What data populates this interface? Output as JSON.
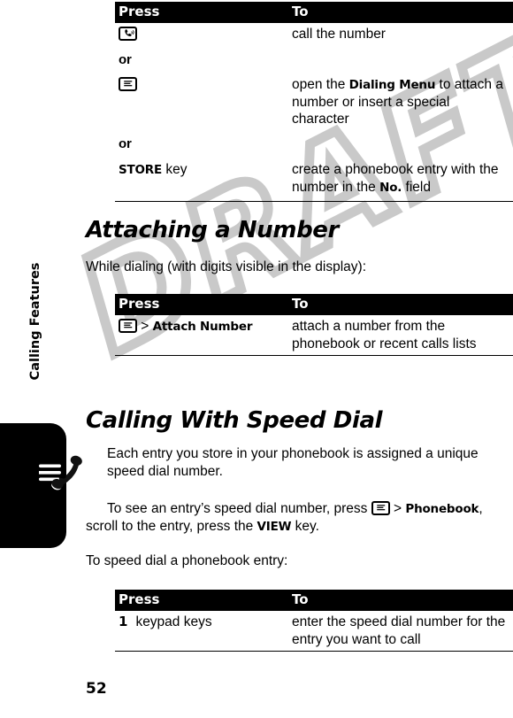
{
  "page": {
    "number": "52",
    "sidebar_label": "Calling Features",
    "watermark_text": "DRAFT"
  },
  "icons": {
    "send_key": "phone-send-key-icon",
    "menu_key": "menu-key-icon",
    "sidebar_handset": "ringing-handset-icon"
  },
  "table1": {
    "headers": {
      "press": "Press",
      "to": "To"
    },
    "rows": [
      {
        "press_icon": "send-key",
        "press_text": "",
        "to": "call the number"
      },
      {
        "press_icon": "",
        "press_text": "or",
        "to": ""
      },
      {
        "press_icon": "menu-key",
        "press_text": "",
        "to_prefix": "open the ",
        "to_keyword": "Dialing Menu",
        "to_suffix": " to attach a number or insert a special character"
      },
      {
        "press_icon": "",
        "press_text": "or",
        "to": ""
      },
      {
        "press_keyword": "STORE",
        "press_text": " key",
        "to_prefix": "create a phonebook entry with the number in the ",
        "to_keyword": "No.",
        "to_suffix": " field"
      }
    ]
  },
  "section1": {
    "heading": "Attaching a Number",
    "intro": "While dialing (with digits visible in the display):"
  },
  "table2": {
    "headers": {
      "press": "Press",
      "to": "To"
    },
    "rows": [
      {
        "press_icon": "menu-key",
        "press_separator": " > ",
        "press_keyword": "Attach Number",
        "to": "attach a number from the phonebook or recent calls lists"
      }
    ]
  },
  "section2": {
    "heading": "Calling With Speed Dial",
    "para1": "Each entry you store in your phonebook is assigned a unique speed dial number.",
    "para2_part1": "To see an entry’s speed dial number, press ",
    "para2_part2": " > ",
    "para2_keyword1": "Phonebook",
    "para2_part3": ", scroll to the entry, press the ",
    "para2_keyword2": "VIEW",
    "para2_part4": " key.",
    "para3": "To speed dial a phonebook entry:"
  },
  "table3": {
    "headers": {
      "press": "Press",
      "to": "To"
    },
    "rows": [
      {
        "step": "1",
        "press_text": "keypad keys",
        "to": "enter the speed dial number for the entry you want to call"
      }
    ]
  },
  "colors": {
    "header_bg": "#000000",
    "header_fg": "#ffffff",
    "text": "#000000",
    "watermark": "#c9c9c9",
    "page_bg": "#ffffff"
  }
}
